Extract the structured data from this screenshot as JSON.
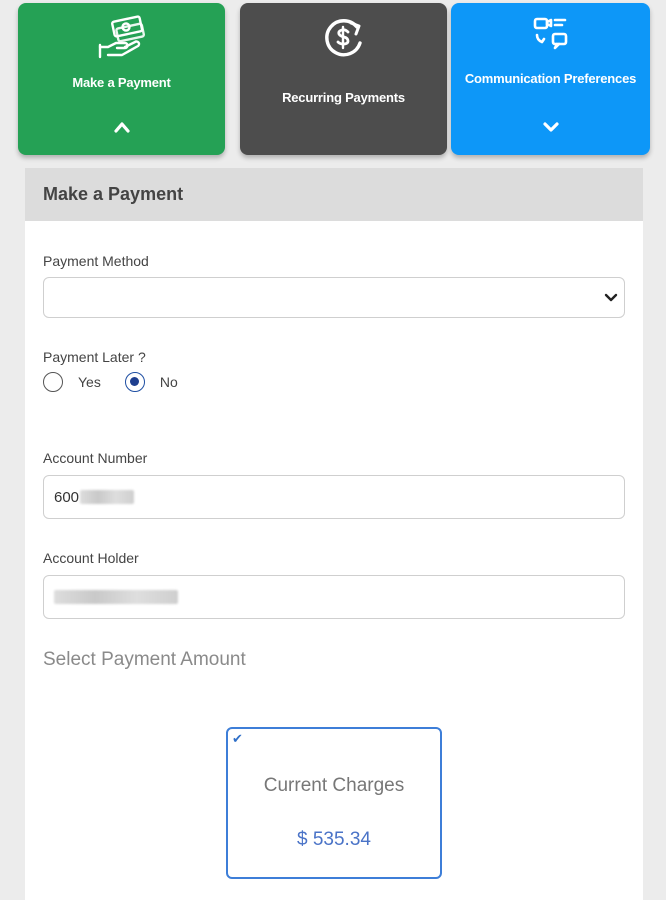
{
  "tiles": [
    {
      "label": "Make a Payment",
      "icon": "hand-money-icon",
      "chevron": "chevron-up-icon",
      "color": "#25a155"
    },
    {
      "label": "Recurring Payments",
      "icon": "recurring-dollar-icon",
      "color": "#4d4d4d"
    },
    {
      "label": "Communication Preferences",
      "icon": "chat-preferences-icon",
      "chevron": "chevron-down-icon",
      "color": "#0d97f8"
    }
  ],
  "panel": {
    "title": "Make a Payment",
    "payment_method": {
      "label": "Payment Method",
      "value": ""
    },
    "payment_later": {
      "label": "Payment Later ?",
      "options": [
        "Yes",
        "No"
      ],
      "selected": "No"
    },
    "account_number": {
      "label": "Account Number",
      "value": "600"
    },
    "account_holder": {
      "label": "Account Holder",
      "value": ""
    },
    "amount_heading": "Select Payment Amount",
    "charge_card": {
      "label": "Current Charges",
      "value": "$ 535.34",
      "selected": true
    }
  },
  "colors": {
    "accent_blue": "#3d7ed8",
    "radio_selected": "#1f3f8f"
  }
}
